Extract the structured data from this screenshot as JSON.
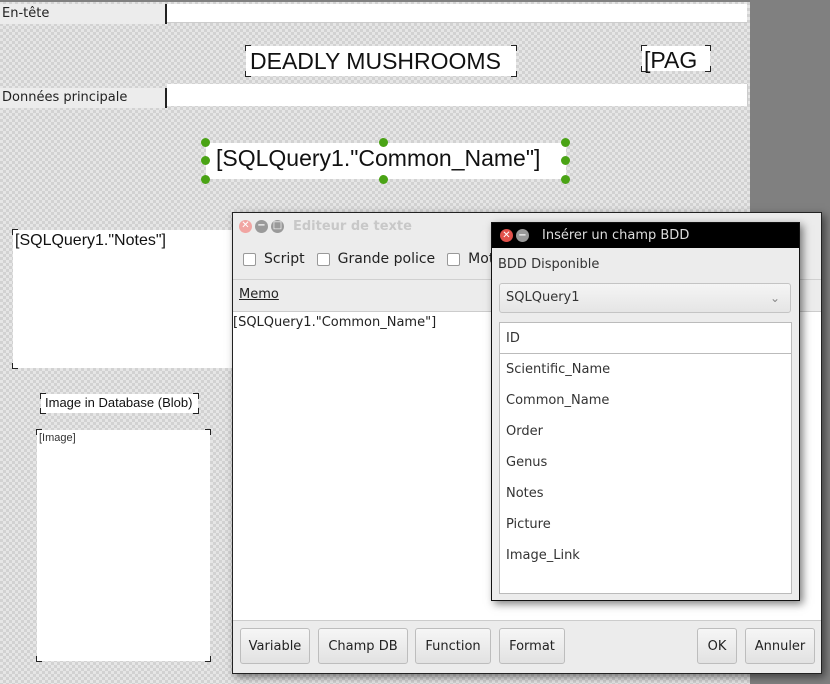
{
  "report": {
    "header_band_label": "En-tête",
    "main_band_label": "Données principale",
    "title_text": "DEADLY MUSHROOMS",
    "page_field_text": "[PAG",
    "common_name_field": "[SQLQuery1.\"Common_Name\"]",
    "notes_field": "[SQLQuery1.\"Notes\"]",
    "image_caption": "Image in Database (Blob)",
    "image_placeholder": "[Image]"
  },
  "text_editor": {
    "title": "Editeur de texte",
    "checkboxes": [
      {
        "label": "Script",
        "checked": false
      },
      {
        "label": "Grande police",
        "checked": false
      },
      {
        "label": "Mots d",
        "checked": false
      }
    ],
    "memo_label": "Memo",
    "memo_content": "[SQLQuery1.\"Common_Name\"]",
    "buttons": {
      "variable": "Variable",
      "db_field": "Champ DB",
      "function": "Function",
      "format": "Format",
      "ok": "OK",
      "cancel": "Annuler"
    }
  },
  "insert_field_dialog": {
    "title": "Insérer un champ BDD",
    "available_db_label": "BDD Disponible",
    "selected_db": "SQLQuery1",
    "fields": [
      "ID",
      "Scientific_Name",
      "Common_Name",
      "Order",
      "Genus",
      "Notes",
      "Picture",
      "Image_Link"
    ]
  },
  "colors": {
    "handle_green": "#4aa315",
    "close_red": "#e2514b"
  }
}
